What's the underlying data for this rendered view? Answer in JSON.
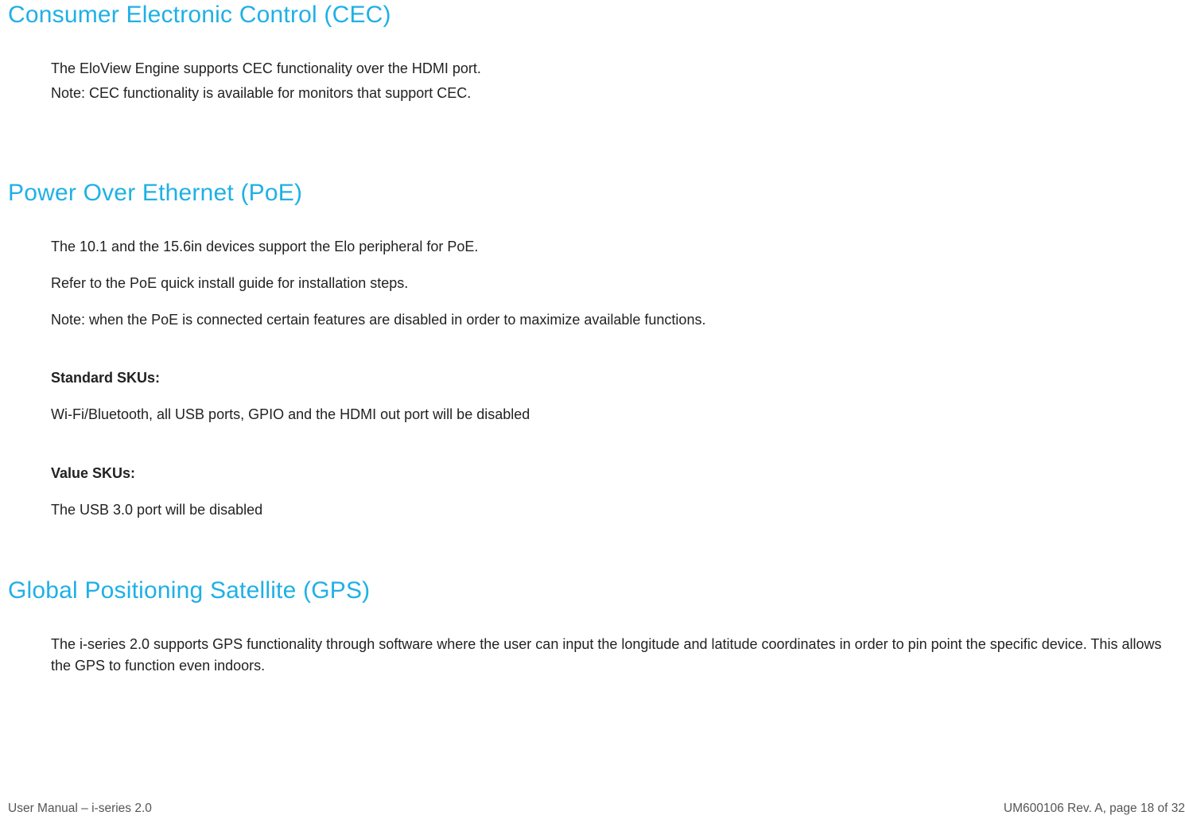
{
  "sections": {
    "cec": {
      "heading": "Consumer Electronic Control (CEC)",
      "p1": "The EloView Engine supports CEC functionality over the HDMI port.",
      "p2": "Note: CEC functionality is available for monitors that support CEC."
    },
    "poe": {
      "heading": "Power Over Ethernet (PoE)",
      "p1": "The 10.1 and the 15.6in devices support the Elo peripheral for PoE.",
      "p2": "Refer to the PoE quick install guide for installation steps.",
      "p3": "Note: when the PoE is connected certain features are disabled in order to maximize available functions.",
      "sub1_label": "Standard SKUs:",
      "sub1_body": "Wi-Fi/Bluetooth, all USB ports, GPIO and the HDMI out port will be disabled",
      "sub2_label": "Value SKUs:",
      "sub2_body": "The USB 3.0 port will be disabled"
    },
    "gps": {
      "heading": "Global Positioning Satellite (GPS)",
      "p1": "The i-series 2.0 supports GPS functionality through software where the user can input the longitude and latitude coordinates in order to pin point the specific device. This allows the GPS to function even indoors."
    }
  },
  "footer": {
    "left": "User Manual – i-series 2.0",
    "right": "UM600106 Rev. A, page 18 of 32"
  }
}
